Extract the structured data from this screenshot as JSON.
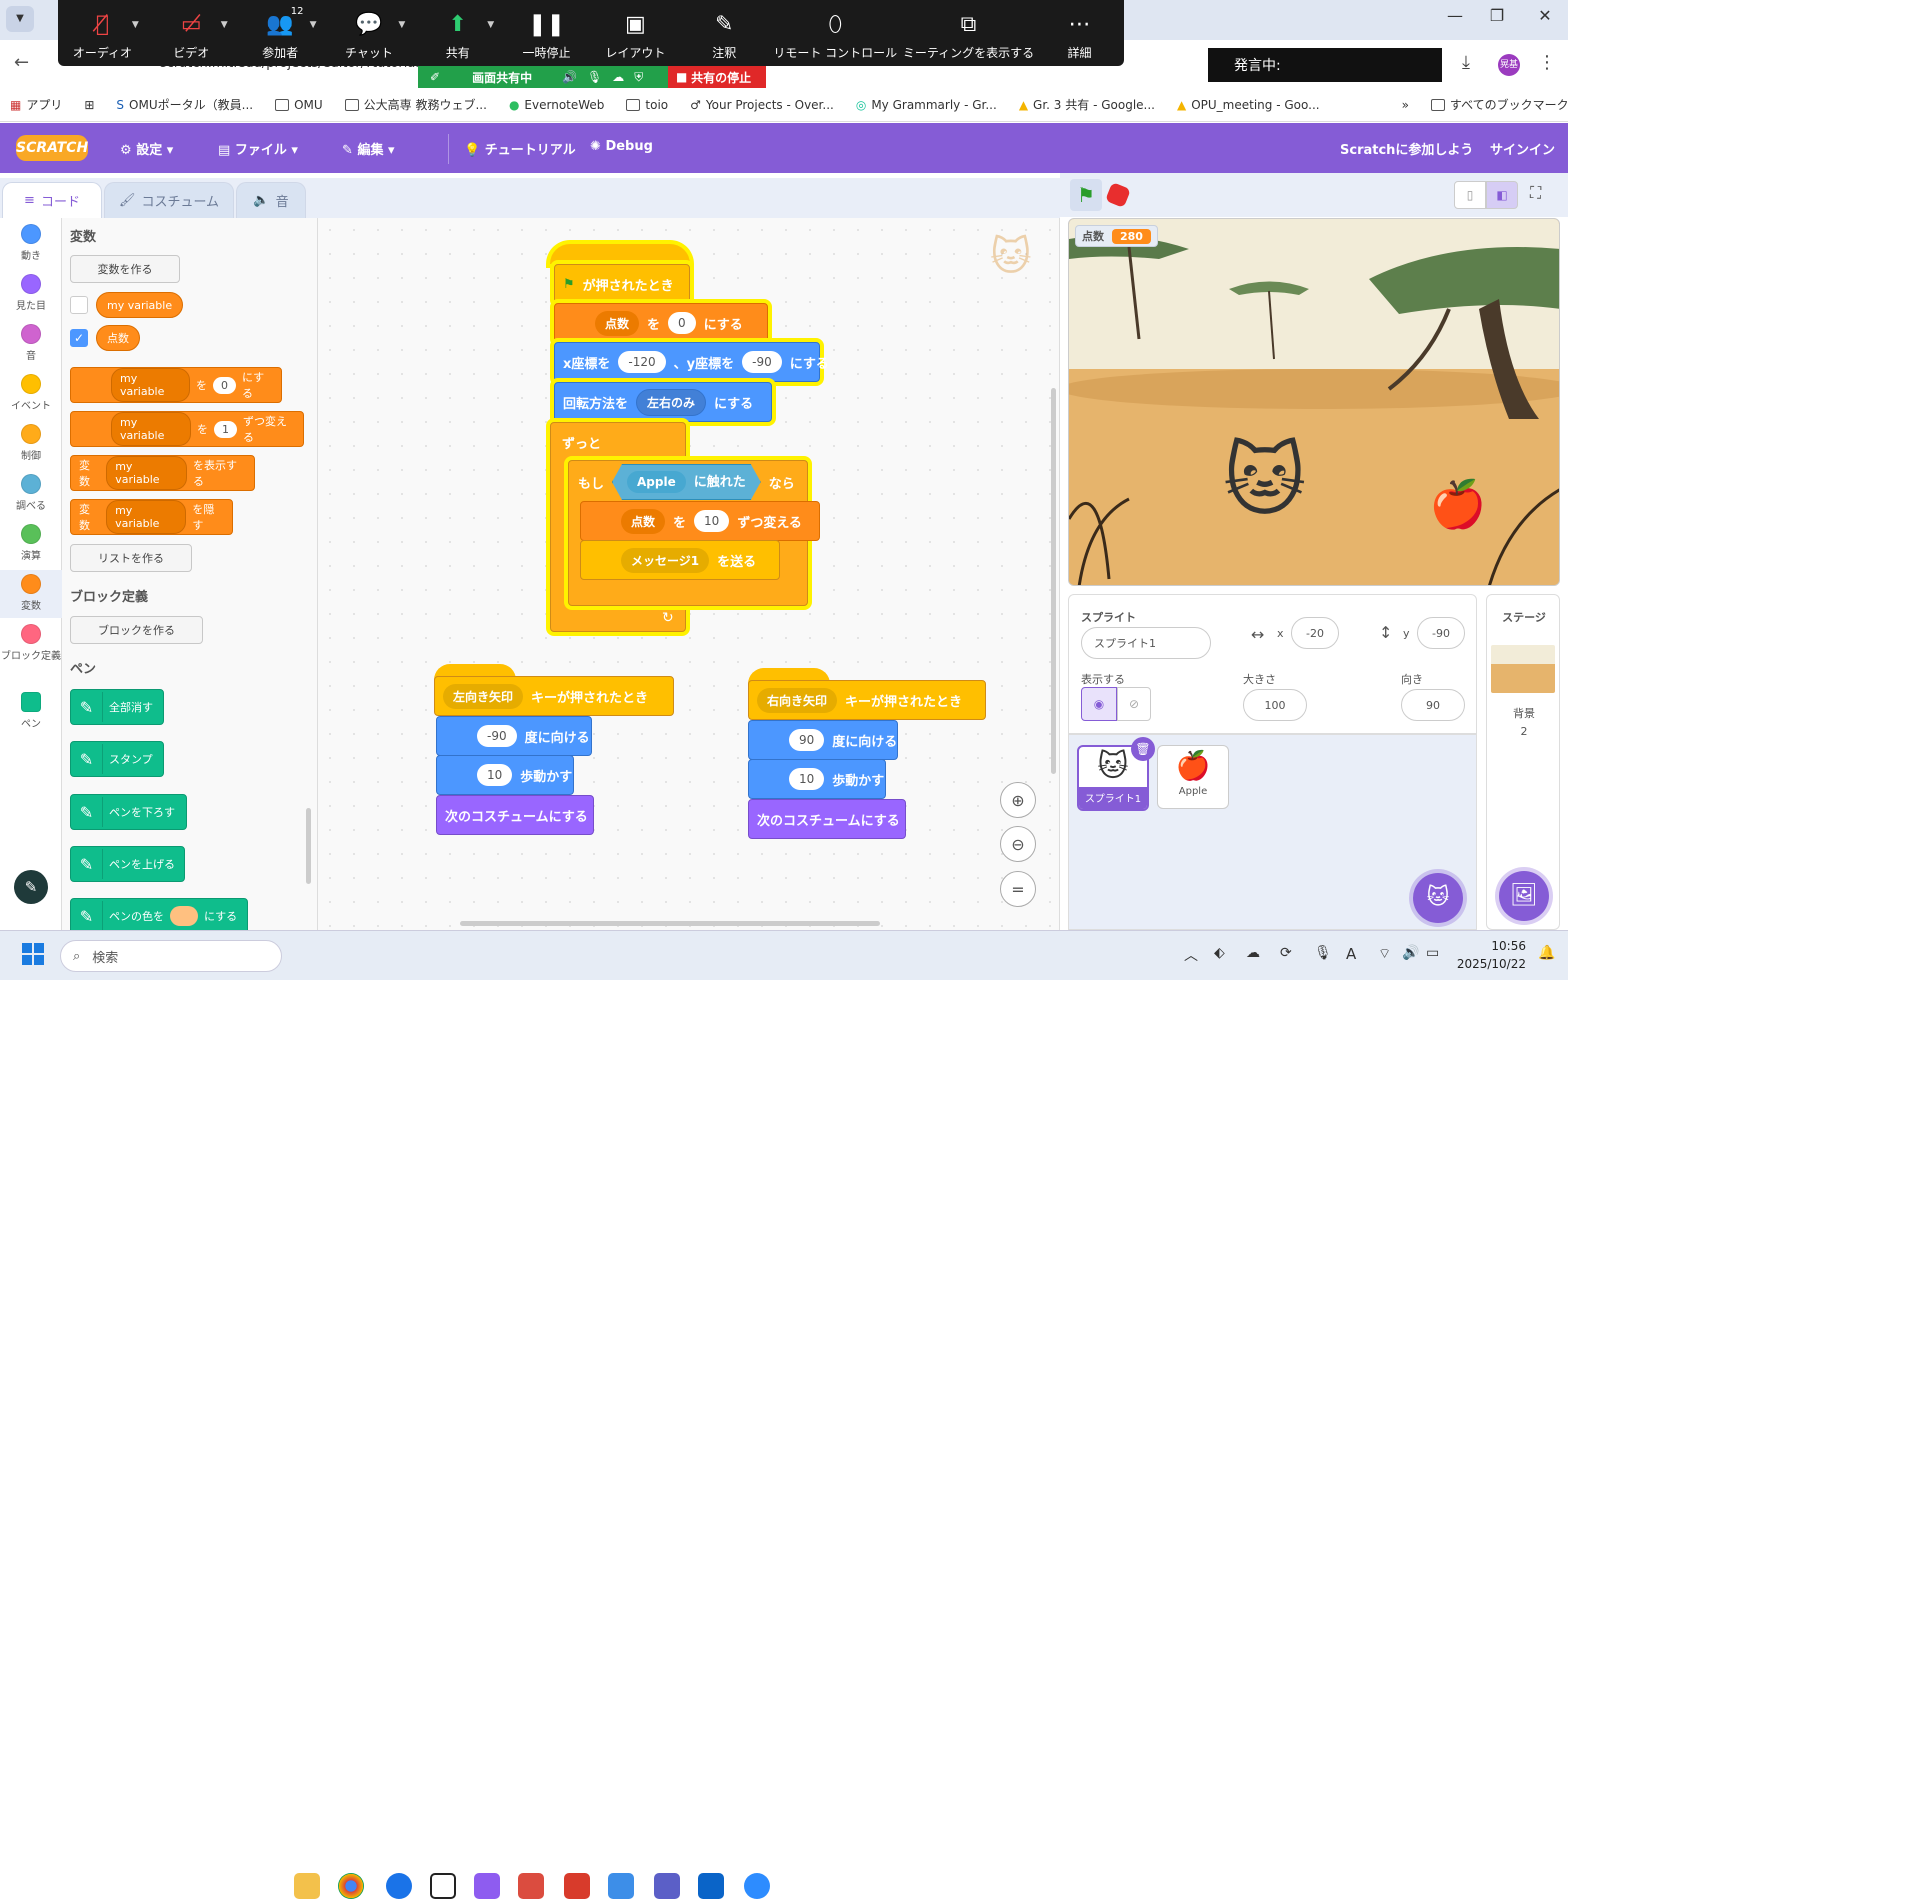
{
  "zoom": {
    "buttons": [
      {
        "label": "オーディオ"
      },
      {
        "label": "ビデオ"
      },
      {
        "label": "参加者",
        "count": "12"
      },
      {
        "label": "チャット"
      },
      {
        "label": "共有"
      },
      {
        "label": "一時停止"
      },
      {
        "label": "レイアウト"
      },
      {
        "label": "注釈"
      },
      {
        "label": "リモート コントロール"
      },
      {
        "label": "ミーティングを表示する"
      },
      {
        "label": "詳細"
      }
    ],
    "sharing": "画面共有中",
    "stop_share": "共有の停止",
    "speaking": "発言中:"
  },
  "browser": {
    "url": "scratch.mit.edu/projects/editor/?tutorial=",
    "bookmarks": [
      "アプリ",
      "OMUポータル（教員...",
      "OMU",
      "公大高専 教務ウェブ...",
      "EvernoteWeb",
      "toio",
      "Your Projects - Over...",
      "My Grammarly - Gr...",
      "Gr. 3 共有 - Google...",
      "OPU_meeting - Goo..."
    ],
    "all_bookmarks": "すべてのブックマーク",
    "profile": "晃基"
  },
  "scratch": {
    "logo": "SCRATCH",
    "menu": {
      "settings": "設定",
      "file": "ファイル",
      "edit": "編集",
      "tutorial": "チュートリアル",
      "debug": "Debug",
      "join": "Scratchに参加しよう",
      "signin": "サインイン"
    },
    "tabs": {
      "code": "コード",
      "costume": "コスチューム",
      "sound": "音"
    },
    "categories": [
      {
        "label": "動き",
        "color": "#4c97ff"
      },
      {
        "label": "見た目",
        "color": "#9966ff"
      },
      {
        "label": "音",
        "color": "#cf63cf"
      },
      {
        "label": "イベント",
        "color": "#ffbf00"
      },
      {
        "label": "制御",
        "color": "#ffab19"
      },
      {
        "label": "調べる",
        "color": "#5cb1d6"
      },
      {
        "label": "演算",
        "color": "#59c059"
      },
      {
        "label": "変数",
        "color": "#ff8c1a"
      },
      {
        "label": "ブロック定義",
        "color": "#ff6680"
      },
      {
        "label": "ペン",
        "color": "#0fbd8c"
      }
    ],
    "palette": {
      "var_heading": "変数",
      "make_var": "変数を作る",
      "var1": "my variable",
      "var2": "点数",
      "set_block": {
        "var": "my variable",
        "to": "を",
        "val": "0",
        "suffix": "にする"
      },
      "change_block": {
        "var": "my variable",
        "to": "を",
        "val": "1",
        "suffix": "ずつ変える"
      },
      "show_block": {
        "prefix": "変数",
        "var": "my variable",
        "suffix": "を表示する"
      },
      "hide_block": {
        "prefix": "変数",
        "var": "my variable",
        "suffix": "を隠す"
      },
      "make_list": "リストを作る",
      "myblocks_heading": "ブロック定義",
      "make_block": "ブロックを作る",
      "pen_heading": "ペン",
      "pen_blocks": [
        "全部消す",
        "スタンプ",
        "ペンを下ろす",
        "ペンを上げる"
      ],
      "pen_color": {
        "prefix": "ペンの色を",
        "suffix": "にする"
      }
    },
    "script1": {
      "hat": "が押されたとき",
      "set_var": "点数",
      "set_to": "を",
      "set_val": "0",
      "set_suffix": "にする",
      "goto_x_prefix": "x座標を",
      "goto_x": "-120",
      "goto_y_prefix": "、y座標を",
      "goto_y": "-90",
      "goto_suffix": "にする",
      "rot_prefix": "回転方法を",
      "rot_val": "左右のみ",
      "rot_suffix": "にする",
      "forever": "ずっと",
      "if": "もし",
      "touch_target": "Apple",
      "touch_text": "に触れた",
      "then": "なら",
      "chg_var": "点数",
      "chg_to": "を",
      "chg_val": "10",
      "chg_suffix": "ずつ変える",
      "msg": "メッセージ1",
      "send": "を送る"
    },
    "script2": {
      "key": "左向き矢印",
      "hat": "キーが押されたとき",
      "dir": "-90",
      "dir_text": "度に向ける",
      "steps": "10",
      "steps_text": "歩動かす",
      "next": "次のコスチュームにする"
    },
    "script3": {
      "key": "右向き矢印",
      "hat": "キーが押されたとき",
      "dir": "90",
      "dir_text": "度に向ける",
      "steps": "10",
      "steps_text": "歩動かす",
      "next": "次のコスチュームにする"
    },
    "monitor": {
      "label": "点数",
      "value": "280"
    },
    "sprite": {
      "heading": "スプライト",
      "name": "スプライト1",
      "x_label": "x",
      "x": "-20",
      "y_label": "y",
      "y": "-90",
      "show_label": "表示する",
      "size_label": "大きさ",
      "size": "100",
      "dir_label": "向き",
      "dir": "90"
    },
    "sprites": [
      "スプライト1",
      "Apple"
    ],
    "stage_panel": {
      "heading": "ステージ",
      "bg_label": "背景",
      "bg_count": "2"
    }
  },
  "taskbar": {
    "search": "検索",
    "time": "10:56",
    "date": "2025/10/22"
  }
}
